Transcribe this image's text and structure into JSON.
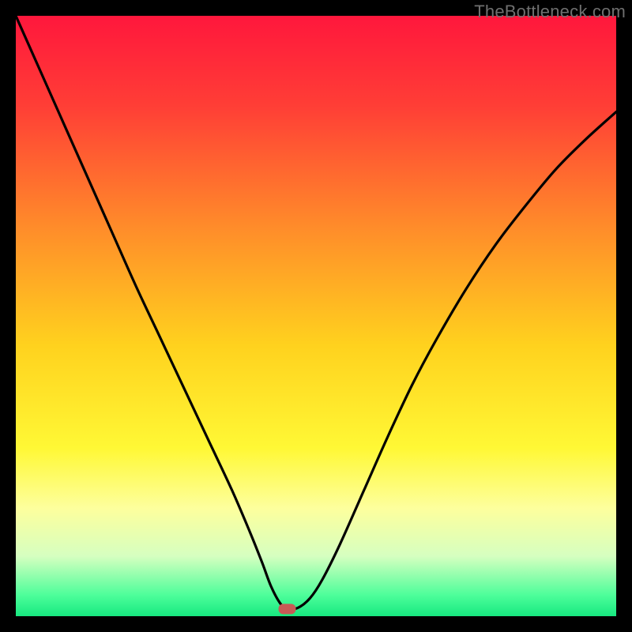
{
  "watermark": "TheBottleneck.com",
  "chart_data": {
    "type": "line",
    "title": "",
    "xlabel": "",
    "ylabel": "",
    "xlim": [
      0,
      100
    ],
    "ylim": [
      0,
      100
    ],
    "background_gradient": {
      "stops": [
        {
          "offset": 0.0,
          "color": "#ff173c"
        },
        {
          "offset": 0.15,
          "color": "#ff3e36"
        },
        {
          "offset": 0.35,
          "color": "#ff8b2a"
        },
        {
          "offset": 0.55,
          "color": "#ffd21e"
        },
        {
          "offset": 0.72,
          "color": "#fff835"
        },
        {
          "offset": 0.82,
          "color": "#fdff9d"
        },
        {
          "offset": 0.9,
          "color": "#d6ffc0"
        },
        {
          "offset": 0.965,
          "color": "#4dfe9a"
        },
        {
          "offset": 1.0,
          "color": "#17e880"
        }
      ]
    },
    "series": [
      {
        "name": "bottleneck-curve",
        "x": [
          0,
          4,
          8,
          12,
          16,
          20,
          24,
          28,
          32,
          36,
          39,
          41,
          42.5,
          44,
          45.2,
          47,
          49,
          51,
          54,
          58,
          62,
          66,
          70,
          75,
          80,
          85,
          90,
          95,
          100
        ],
        "y": [
          100,
          91,
          82,
          73,
          64,
          55,
          46.5,
          38,
          29.5,
          21,
          14,
          9,
          5,
          2.2,
          1.2,
          1.4,
          3,
          6,
          12,
          21,
          30,
          38.5,
          46,
          54.5,
          62,
          68.5,
          74.5,
          79.5,
          84
        ]
      }
    ],
    "marker": {
      "name": "optimum-marker",
      "x": 45.2,
      "y": 1.2,
      "color": "#c75a56"
    }
  }
}
